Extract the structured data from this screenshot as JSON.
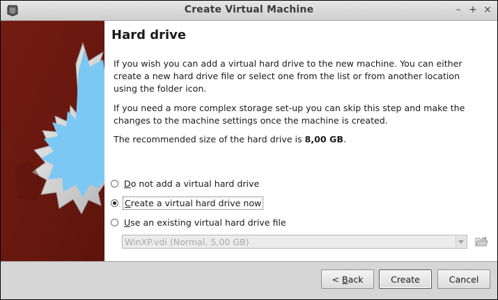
{
  "window": {
    "title": "Create Virtual Machine"
  },
  "page": {
    "heading": "Hard drive",
    "para1": "If you wish you can add a virtual hard drive to the new machine. You can either create a new hard drive file or select one from the list or from another location using the folder icon.",
    "para2": "If you need a more complex storage set-up you can skip this step and make the changes to the machine settings once the machine is created.",
    "para3_prefix": "The recommended size of the hard drive is ",
    "para3_size": "8,00 GB",
    "para3_suffix": "."
  },
  "options": [
    {
      "mnemonic": "D",
      "rest": "o not add a virtual hard drive",
      "checked": false
    },
    {
      "mnemonic": "C",
      "rest": "reate a virtual hard drive now",
      "checked": true
    },
    {
      "mnemonic": "U",
      "rest": "se an existing virtual hard drive file",
      "checked": false
    }
  ],
  "existing_file": {
    "selected": "WinXP.vdi (Normal, 5,00 GB)"
  },
  "buttons": {
    "back_prefix": "< ",
    "back_mnemonic": "B",
    "back_rest": "ack",
    "create": "Create",
    "cancel": "Cancel"
  },
  "colors": {
    "banner_bg": "#6e1a10",
    "banner_star_face": "#7cc8f4",
    "banner_star_body": "#dcdcdc"
  },
  "icons": {
    "app": "virtualbox-icon",
    "minimize": "minimize-icon",
    "maximize": "maximize-icon",
    "close": "close-icon",
    "folder": "folder-open-icon"
  }
}
